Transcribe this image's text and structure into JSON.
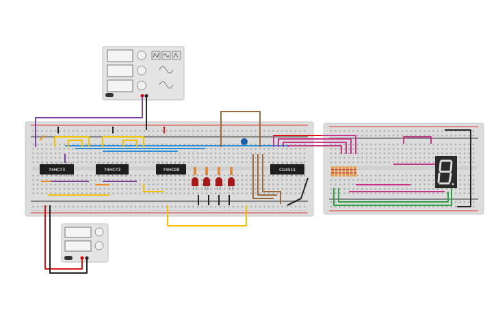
{
  "function_generator": {
    "on": false
  },
  "power_supply": {
    "on": false
  },
  "chips": [
    {
      "label": "74HC73"
    },
    {
      "label": "74HC73"
    },
    {
      "label": "74HC08"
    },
    {
      "label": "CD4511"
    }
  ],
  "leds": [
    {
      "on": false
    },
    {
      "on": false
    },
    {
      "on": false
    },
    {
      "on": false
    }
  ],
  "display": {
    "segments": [
      {
        "on": false
      },
      {
        "on": false
      },
      {
        "on": false
      },
      {
        "on": false
      },
      {
        "on": false
      },
      {
        "on": false
      },
      {
        "on": false
      }
    ]
  }
}
